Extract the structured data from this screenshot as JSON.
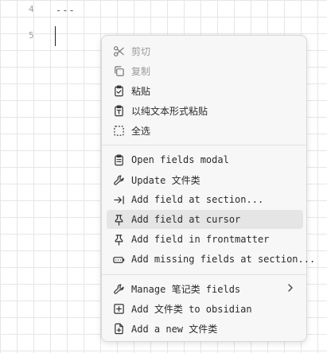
{
  "editor": {
    "line_numbers": [
      "4",
      "5"
    ],
    "line4_text": "---"
  },
  "context_menu": {
    "items": [
      {
        "label": "剪切",
        "icon": "scissors-icon",
        "disabled": true
      },
      {
        "label": "复制",
        "icon": "copy-icon",
        "disabled": true
      },
      {
        "label": "粘贴",
        "icon": "clipboard-check-icon",
        "disabled": false
      },
      {
        "label": "以纯文本形式粘贴",
        "icon": "clipboard-type-icon",
        "disabled": false
      },
      {
        "label": "全选",
        "icon": "select-all-icon",
        "disabled": false
      },
      {
        "label": "Open fields modal",
        "icon": "clipboard-list-icon",
        "disabled": false
      },
      {
        "label": "Update 文件类",
        "icon": "wrench-icon",
        "disabled": false
      },
      {
        "label": "Add field at section...",
        "icon": "arrow-right-to-line-icon",
        "disabled": false
      },
      {
        "label": "Add field at cursor",
        "icon": "pin-icon",
        "disabled": false,
        "highlighted": true
      },
      {
        "label": "Add field in frontmatter",
        "icon": "pin-icon",
        "disabled": false
      },
      {
        "label": "Add missing fields at section...",
        "icon": "battery-plus-icon",
        "disabled": false
      },
      {
        "label": "Manage 笔记类 fields",
        "icon": "wrench-icon",
        "disabled": false,
        "submenu": true
      },
      {
        "label": "Add 文件类 to obsidian",
        "icon": "plus-square-icon",
        "disabled": false
      },
      {
        "label": "Add a new 文件类",
        "icon": "file-plus-icon",
        "disabled": false
      }
    ]
  }
}
